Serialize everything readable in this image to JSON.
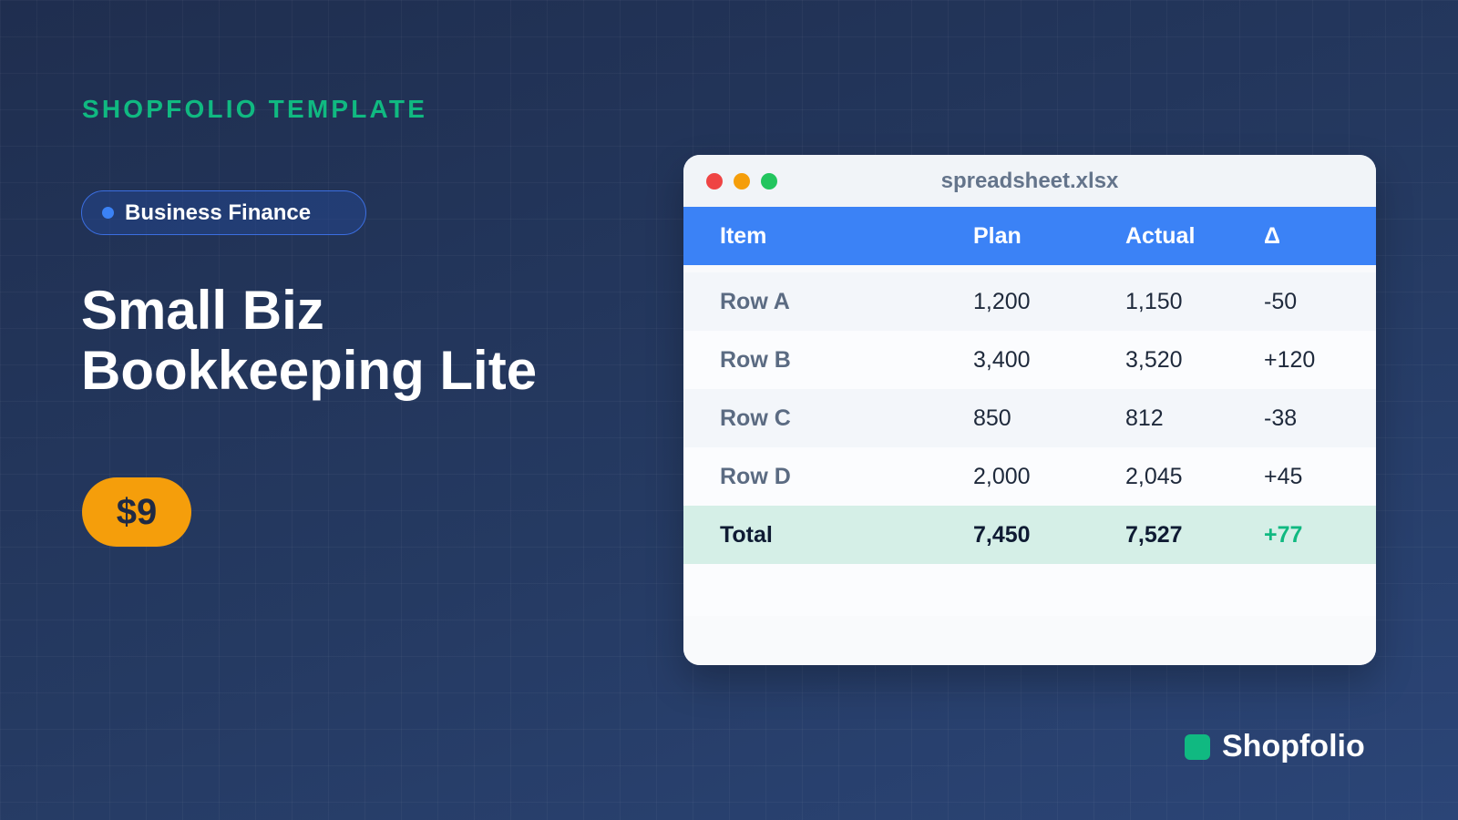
{
  "header": {
    "eyebrow": "SHOPFOLIO TEMPLATE",
    "category": "Business Finance",
    "title_line1": "Small Biz",
    "title_line2": "Bookkeeping Lite",
    "price": "$9"
  },
  "window": {
    "filename": "spreadsheet.xlsx",
    "columns": [
      "Item",
      "Plan",
      "Actual",
      "Δ"
    ],
    "rows": [
      [
        "Row A",
        "1,200",
        "1,150",
        "-50"
      ],
      [
        "Row B",
        "3,400",
        "3,520",
        "+120"
      ],
      [
        "Row C",
        "850",
        "812",
        "-38"
      ],
      [
        "Row D",
        "2,000",
        "2,045",
        "+45"
      ]
    ],
    "total": [
      "Total",
      "7,450",
      "7,527",
      "+77"
    ]
  },
  "brand": {
    "name": "Shopfolio"
  },
  "colors": {
    "accent_green": "#10b981",
    "accent_blue": "#3b82f6",
    "price_orange": "#f59e0b",
    "background": "#233760"
  }
}
